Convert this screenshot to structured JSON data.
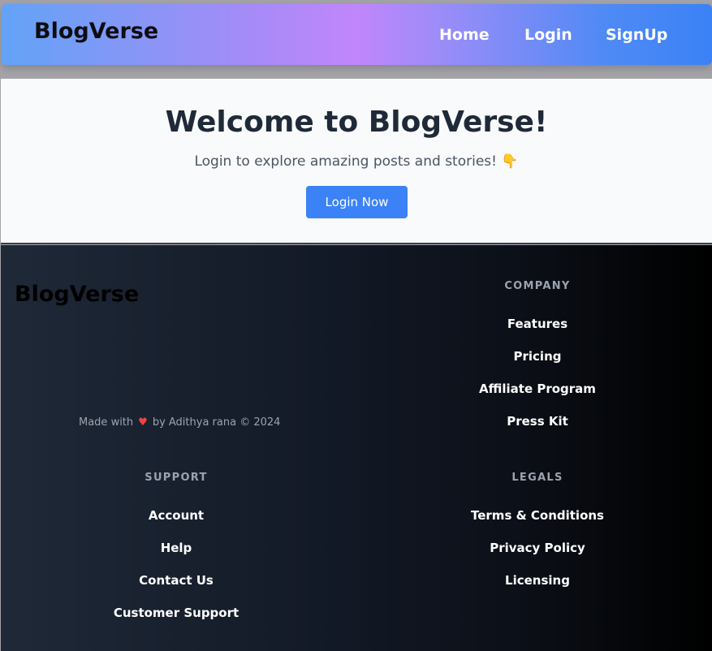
{
  "navbar": {
    "brand": "BlogVerse",
    "links": [
      "Home",
      "Login",
      "SignUp"
    ]
  },
  "hero": {
    "title": "Welcome to BlogVerse!",
    "subtitle": "Login to explore amazing posts and stories! 👇",
    "button_label": "Login Now"
  },
  "footer": {
    "brand": "BlogVerse",
    "made_with_prefix": "Made with",
    "heart": "♥",
    "made_with_suffix": "by Adithya rana © 2024",
    "company": {
      "heading": "COMPANY",
      "items": [
        "Features",
        "Pricing",
        "Affiliate Program",
        "Press Kit"
      ]
    },
    "support": {
      "heading": "SUPPORT",
      "items": [
        "Account",
        "Help",
        "Contact Us",
        "Customer Support"
      ]
    },
    "legals": {
      "heading": "LEGALS",
      "items": [
        "Terms & Conditions",
        "Privacy Policy",
        "Licensing"
      ]
    }
  },
  "colors": {
    "accent": "#3b82f6",
    "heart": "#ef4444",
    "hero_bg": "#f8fafc",
    "footer_start": "#1f2937",
    "footer_end": "#000000"
  }
}
